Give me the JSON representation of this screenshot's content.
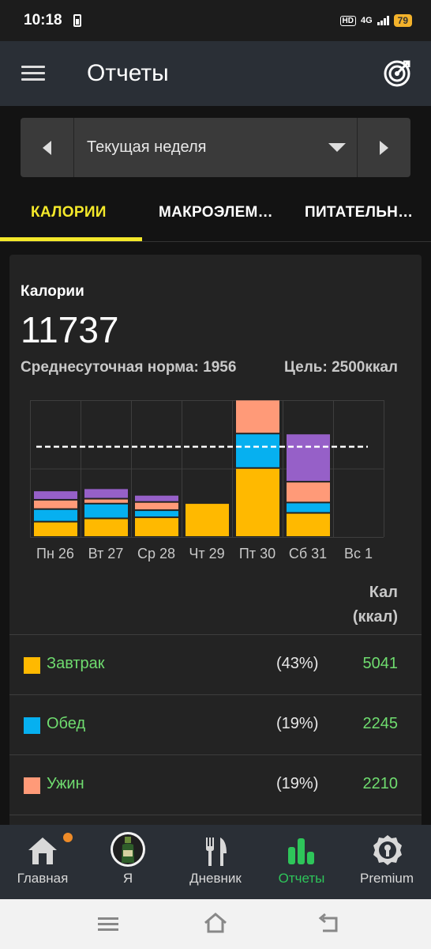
{
  "status_bar": {
    "time": "10:18",
    "network": "4G",
    "battery": "79"
  },
  "app_bar": {
    "title": "Отчеты",
    "menu_icon": "hamburger-menu-icon",
    "goal_icon": "target-icon"
  },
  "period": {
    "label": "Текущая неделя"
  },
  "tabs": [
    {
      "label": "КАЛОРИИ",
      "active": true
    },
    {
      "label": "МАКРОЭЛЕМ…",
      "active": false
    },
    {
      "label": "ПИТАТЕЛЬН…",
      "active": false
    }
  ],
  "summary": {
    "label": "Калории",
    "total": "11737",
    "avg": "Среднесуточная норма: 1956",
    "goal": "Цель: 2500ккал"
  },
  "chart_data": {
    "type": "bar",
    "stacked": true,
    "categories": [
      "Пн 26",
      "Вт 27",
      "Ср 28",
      "Чт 29",
      "Пт 30",
      "Сб 31",
      "Вс 1"
    ],
    "series": [
      {
        "name": "Завтрак",
        "color": "#ffb900",
        "values": [
          280,
          340,
          360,
          620,
          1260,
          440,
          0
        ]
      },
      {
        "name": "Обед",
        "color": "#06b0f0",
        "values": [
          230,
          270,
          130,
          0,
          630,
          190,
          0
        ]
      },
      {
        "name": "Ужин",
        "color": "#ff9a78",
        "values": [
          170,
          90,
          150,
          0,
          620,
          380,
          0
        ]
      },
      {
        "name": "",
        "color": "#9660c8",
        "values": [
          170,
          190,
          130,
          0,
          0,
          880,
          0
        ]
      }
    ],
    "goal_line": 1650,
    "ylim": [
      0,
      2500
    ],
    "grid": true
  },
  "table": {
    "header_line1": "Кал",
    "header_line2": "(ккал)",
    "rows": [
      {
        "name": "Завтрак",
        "color": "#ffb900",
        "percent": "(43%)",
        "value": "5041"
      },
      {
        "name": "Обед",
        "color": "#06b0f0",
        "percent": "(19%)",
        "value": "2245"
      },
      {
        "name": "Ужин",
        "color": "#ff9a78",
        "percent": "(19%)",
        "value": "2210"
      }
    ]
  },
  "bottom_nav": [
    {
      "label": "Главная",
      "icon": "home-icon",
      "active": false
    },
    {
      "label": "Я",
      "icon": "avatar-icon",
      "active": false
    },
    {
      "label": "Дневник",
      "icon": "fork-knife-icon",
      "active": false
    },
    {
      "label": "Отчеты",
      "icon": "bar-chart-icon",
      "active": true
    },
    {
      "label": "Premium",
      "icon": "premium-badge-icon",
      "active": false
    }
  ],
  "accent_color": "#f3e82a",
  "active_nav_color": "#2ec55a"
}
